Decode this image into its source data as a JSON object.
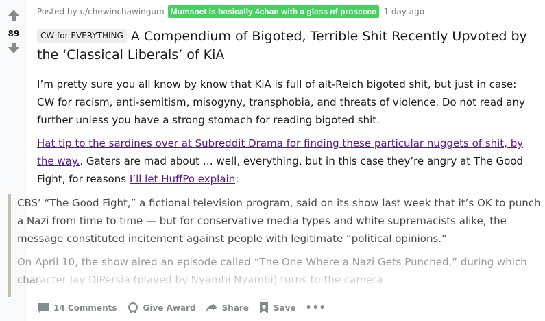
{
  "vote": {
    "count": "89"
  },
  "meta": {
    "posted_by": "Posted by u/chewinchawingum",
    "flair": "Mumsnet is basically 4chan with a glass of prosecco",
    "age": "1 day ago"
  },
  "post": {
    "title_flair": "CW for EVERYTHING",
    "title": "A Compendium of Bigoted, Terrible Shit Recently Upvoted by the ‘Classical Liberals’ of KiA",
    "para1": "I’m pretty sure you all know by know that KiA is full of alt-Reich bigoted shit, but just in case: CW for racism, anti-semitism, misogyny, transphobia, and threats of violence. Do not read any further unless you have a strong stomach for reading bigoted shit.",
    "link1": "Hat tip to the sardines over at Subreddit Drama for finding these particular nuggets of shit, by the way.",
    "para2_mid": ". Gaters are mad about … well, everything, but in this case they’re angry at The Good Fight, for reasons ",
    "link2": "I’ll let HuffPo explain",
    "para2_end": ":",
    "quote1": "CBS’ “The Good Fight,” a fictional television program, said on its show last week that it’s OK to punch a Nazi from time to time — but for conservative media types and white supremacists alike, the message constituted incitement against people with legitimate “political opinions.”",
    "quote2": "On April 10, the show aired an episode called “The One Where a Nazi Gets Punched,” during which character Jay DiPersia (played by Nyambi Nyambi) turns to the camera"
  },
  "actions": {
    "comments": "14 Comments",
    "award": "Give Award",
    "share": "Share",
    "save": "Save",
    "more": "•••"
  },
  "colors": {
    "flair_bg": "#46d160",
    "link_visited": "#551a8b",
    "quote_border": "#c5c1ad",
    "vote_rail_bg": "#f8f9fa"
  }
}
